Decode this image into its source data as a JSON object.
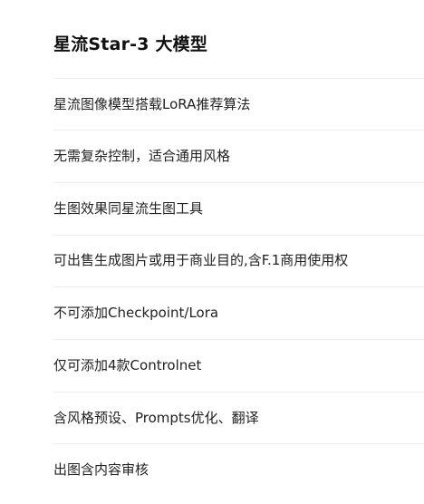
{
  "plan": {
    "title": "星流Star-3 大模型",
    "features": [
      "星流图像模型搭载LoRA推荐算法",
      "无需复杂控制，适合通用风格",
      "生图效果同星流生图工具",
      "可出售生成图片或用于商业目的,含F.1商用使用权",
      "不可添加Checkpoint/Lora",
      "仅可添加4款Controlnet",
      "含风格预设、Prompts优化、翻译",
      "出图含内容审核"
    ]
  }
}
